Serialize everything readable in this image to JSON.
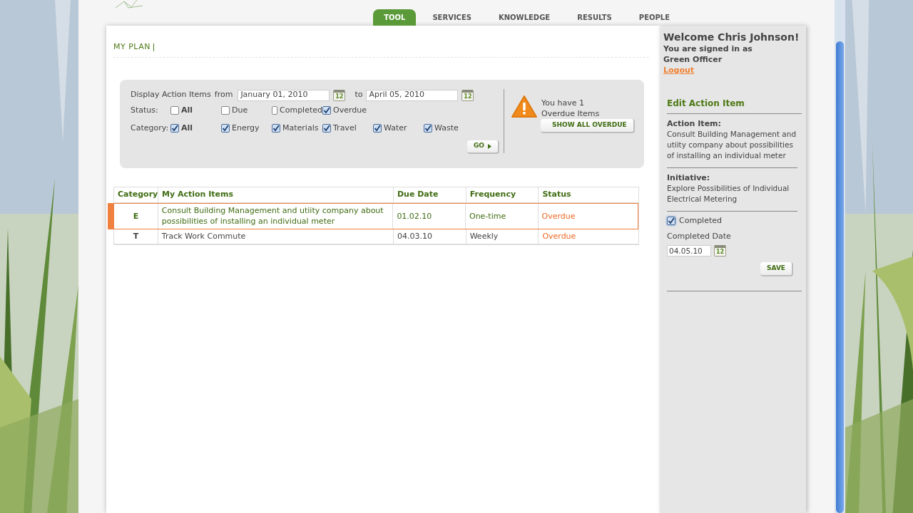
{
  "nav": {
    "tabs": [
      {
        "label": "TOOL",
        "selected": true
      },
      {
        "label": "SERVICES",
        "selected": false
      },
      {
        "label": "KNOWLEDGE",
        "selected": false
      },
      {
        "label": "RESULTS",
        "selected": false
      },
      {
        "label": "PEOPLE",
        "selected": false
      }
    ]
  },
  "page_title": "MY PLAN",
  "filter": {
    "display_label": "Display Action Items",
    "from_label": "from",
    "from_date": {
      "value": "January 01, 2010",
      "calendar_text": "12"
    },
    "to_label": "to",
    "to_date": {
      "value": "April 05, 2010",
      "calendar_text": "12"
    },
    "groups": [
      {
        "label": "Status:",
        "options": [
          {
            "label": "All",
            "kind": "all",
            "checked": false
          },
          {
            "label": "Due",
            "kind": "item",
            "checked": false
          },
          {
            "label": "Completed",
            "kind": "item",
            "checked": false
          },
          {
            "label": "Overdue",
            "kind": "item",
            "checked": true
          }
        ]
      },
      {
        "label": "Category:",
        "options": [
          {
            "label": "All",
            "kind": "all",
            "checked": true
          },
          {
            "label": "Energy",
            "kind": "item",
            "checked": true
          },
          {
            "label": "Materials",
            "kind": "item",
            "checked": true
          },
          {
            "label": "Travel",
            "kind": "item",
            "checked": true
          },
          {
            "label": "Water",
            "kind": "item",
            "checked": true
          },
          {
            "label": "Waste",
            "kind": "item",
            "checked": true
          }
        ]
      }
    ],
    "go_button": "GO"
  },
  "alert": {
    "message": "You have 1 Overdue Items",
    "button": "SHOW ALL OVERDUE"
  },
  "table": {
    "columns": [
      "Category",
      "My Action Items",
      "Due Date",
      "Frequency",
      "Status"
    ],
    "rows": [
      {
        "category": "E",
        "item": "Consult Building Management and utiity company about possibilities of installing an individual meter",
        "due_date": "01.02.10",
        "frequency": "One-time",
        "status": "Overdue",
        "selected": true
      },
      {
        "category": "T",
        "item": "Track Work Commute",
        "due_date": "04.03.10",
        "frequency": "Weekly",
        "status": "Overdue",
        "selected": false
      }
    ]
  },
  "sidebar": {
    "welcome": "Welcome Chris Johnson!",
    "signed_in": "You are signed in as",
    "role": "Green Officer",
    "logout": "Logout",
    "edit_title": "Edit Action Item",
    "action_item_label": "Action Item:",
    "action_item_text": "Consult Building Management and utiity company about possibilities of installing an individual meter",
    "initiative_label": "Initiative:",
    "initiative_text": "Explore Possibilities of Individual Electrical Metering",
    "completed": {
      "label": "Completed",
      "checked": true
    },
    "completed_date_label": "Completed Date",
    "completed_date": {
      "value": "04.05.10",
      "calendar_text": "12"
    },
    "save_button": "SAVE"
  }
}
